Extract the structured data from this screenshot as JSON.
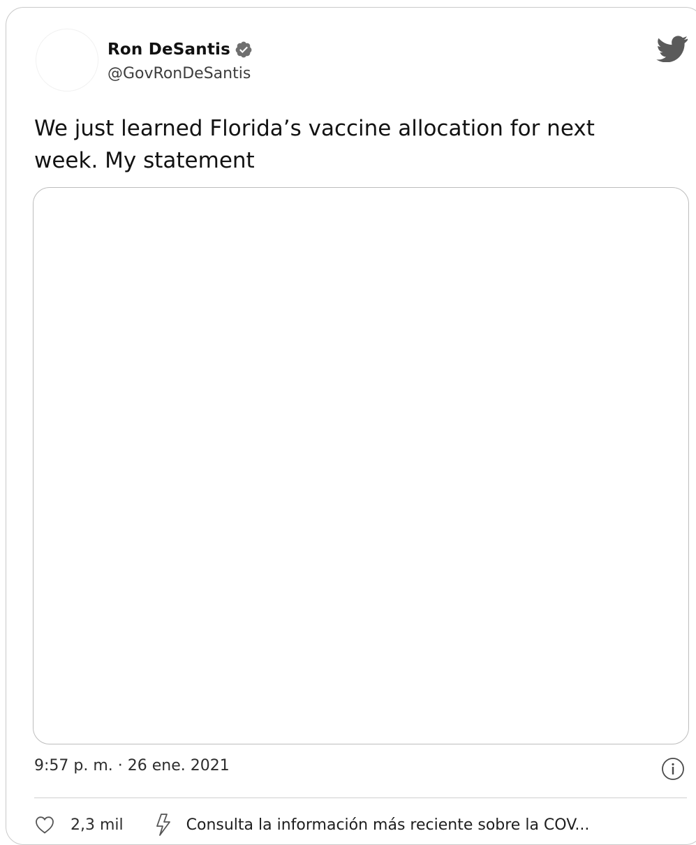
{
  "tweet": {
    "author": {
      "display_name": "Ron DeSantis",
      "handle": "@GovRonDeSantis",
      "verified": true
    },
    "text": "We just learned Florida’s vaccine allocation for next week. My statement",
    "timestamp": "9:57 p. m. · 26 ene. 2021",
    "likes": "2,3 mil",
    "covid_notice": "Consulta la información más reciente sobre la COV..."
  },
  "icons": {
    "brand": "twitter-bird-icon",
    "verified": "verified-badge-icon",
    "info": "info-icon",
    "like": "heart-icon",
    "covid": "lightning-icon"
  },
  "colors": {
    "border": "#c9c9c9",
    "text": "#141414",
    "icon_gray": "#666666"
  }
}
